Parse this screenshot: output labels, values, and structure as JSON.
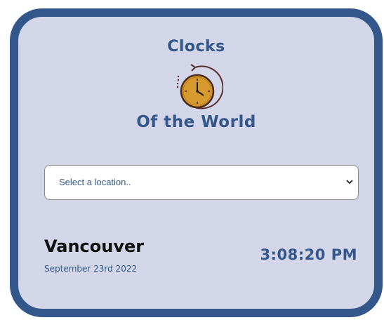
{
  "header": {
    "title_top": "Clocks",
    "title_bottom": "Of the World",
    "logo_icon": "clock-icon"
  },
  "location_select": {
    "selected_value": "Select a location.."
  },
  "clock": {
    "city": "Vancouver",
    "date": "September 23rd 2022",
    "time": "3:08:20 PM"
  },
  "colors": {
    "card_background": "#d2d6e8",
    "card_border": "#33578a",
    "accent_text": "#33578a",
    "city_text": "#111111",
    "logo_face": "#d79a2e"
  }
}
